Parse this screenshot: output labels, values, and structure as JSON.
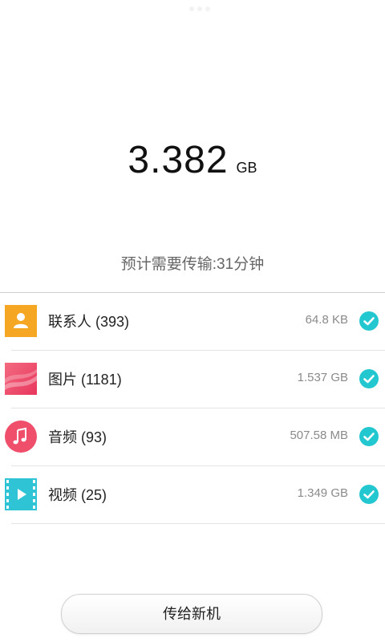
{
  "summary": {
    "total_size": "3.382",
    "total_unit": "GB",
    "eta_text": "预计需要传输:31分钟"
  },
  "items": [
    {
      "label": "联系人 (393)",
      "size": "64.8 KB",
      "icon": "contacts-icon",
      "checked": true,
      "color": "#f5a623"
    },
    {
      "label": "图片 (1181)",
      "size": "1.537 GB",
      "icon": "photos-icon",
      "checked": true,
      "color": "#f0506e"
    },
    {
      "label": "音频 (93)",
      "size": "507.58 MB",
      "icon": "music-icon",
      "checked": true,
      "color": "#ef4f6a"
    },
    {
      "label": "视频 (25)",
      "size": "1.349 GB",
      "icon": "video-icon",
      "checked": true,
      "color": "#2ec4d6"
    }
  ],
  "actions": {
    "send_label": "传给新机"
  },
  "colors": {
    "accent": "#22c7cf"
  }
}
